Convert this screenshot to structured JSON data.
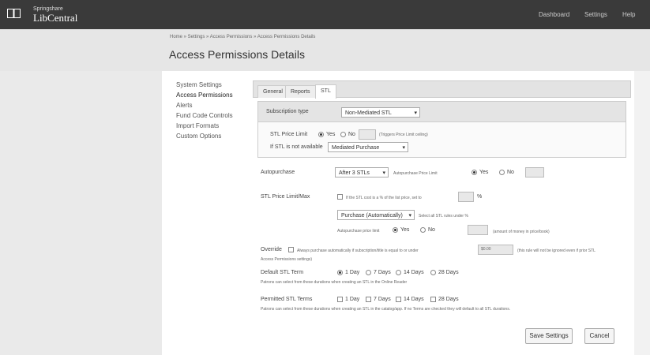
{
  "brand": {
    "small": "Springshare",
    "name": "LibCentral"
  },
  "topnav": [
    "Dashboard",
    "Settings",
    "Help"
  ],
  "breadcrumb": "Home » Settings » Access Permissions » Access Permissions Details",
  "page_title": "Access Permissions Details",
  "sidenav": [
    "System Settings",
    "Access Permissions",
    "Alerts",
    "Fund Code Controls",
    "Import Formats",
    "Custom Options"
  ],
  "tabs": [
    "General",
    "Reports",
    "STL"
  ],
  "stl": {
    "subscription_label": "Subscription type",
    "subscription_value": "Non-Mediated STL",
    "stl_price_limit_label": "STL Price Limit",
    "yes": "Yes",
    "no": "No",
    "price_limit_note": "(Triggers Price Limit ceiling)",
    "if_stl_not_available_label": "If STL is not available",
    "if_stl_not_available_value": "Mediated Purchase"
  },
  "auto_purchase": {
    "label": "Autopurchase",
    "select_value": "After 3 STLs",
    "subject_label": "Autopurchase Price Limit",
    "yes": "Yes",
    "no": "No"
  },
  "stl_limit": {
    "label": "STL Price Limit/Max",
    "checkbox_label": "If the STL cost is a % of the list price, set to",
    "pct": "%",
    "select_value": "Purchase (Automatically)",
    "select_note": "Select all STL rules under %",
    "subject_label": "Autopurchase price limit",
    "yes": "Yes",
    "no": "No",
    "subject_note": "(amount of money in price/book)"
  },
  "override": {
    "label": "Override",
    "text": "Always purchase automatically if subscription/title is equal to or under",
    "amount": "$0.00",
    "note": "(this rule will not be ignored even if prior STL",
    "second_line": "Access Permissions settings)"
  },
  "default_stl": {
    "label": "Default STL Term",
    "options": [
      "1 Day",
      "7 Days",
      "14 Days",
      "28 Days"
    ],
    "note": "Patrons can select from these durations when creating an STL in the Online Reader"
  },
  "permitted_stl": {
    "label": "Permitted STL Terms",
    "options": [
      "1 Day",
      "7 Days",
      "14 Days",
      "28 Days"
    ],
    "note": "Patrons can select from these durations when creating an STL in the catalog/app. If no Terms are checked they will default to all STL durations."
  },
  "buttons": {
    "save": "Save Settings",
    "cancel": "Cancel"
  }
}
